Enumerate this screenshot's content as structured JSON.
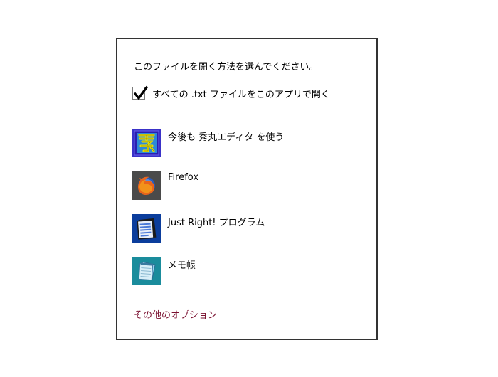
{
  "dialog": {
    "prompt": "このファイルを開く方法を選んでください。",
    "always_use": {
      "label": "すべての .txt ファイルをこのアプリで開く",
      "checked": true
    },
    "apps": [
      {
        "label": "今後も 秀丸エディタ を使う",
        "icon": "hidemaru-icon"
      },
      {
        "label": "Firefox",
        "icon": "firefox-icon"
      },
      {
        "label": "Just Right! プログラム",
        "icon": "just-right-icon"
      },
      {
        "label": "メモ帳",
        "icon": "notepad-icon"
      }
    ],
    "more_options_label": "その他のオプション",
    "colors": {
      "border": "#333333",
      "link": "#7a1030",
      "hidemaru_bg": "#3a32c8",
      "firefox_bg": "#4a4a4a",
      "just_right_bg": "#0b3d9c",
      "notepad_bg": "#1a8c9c"
    }
  }
}
